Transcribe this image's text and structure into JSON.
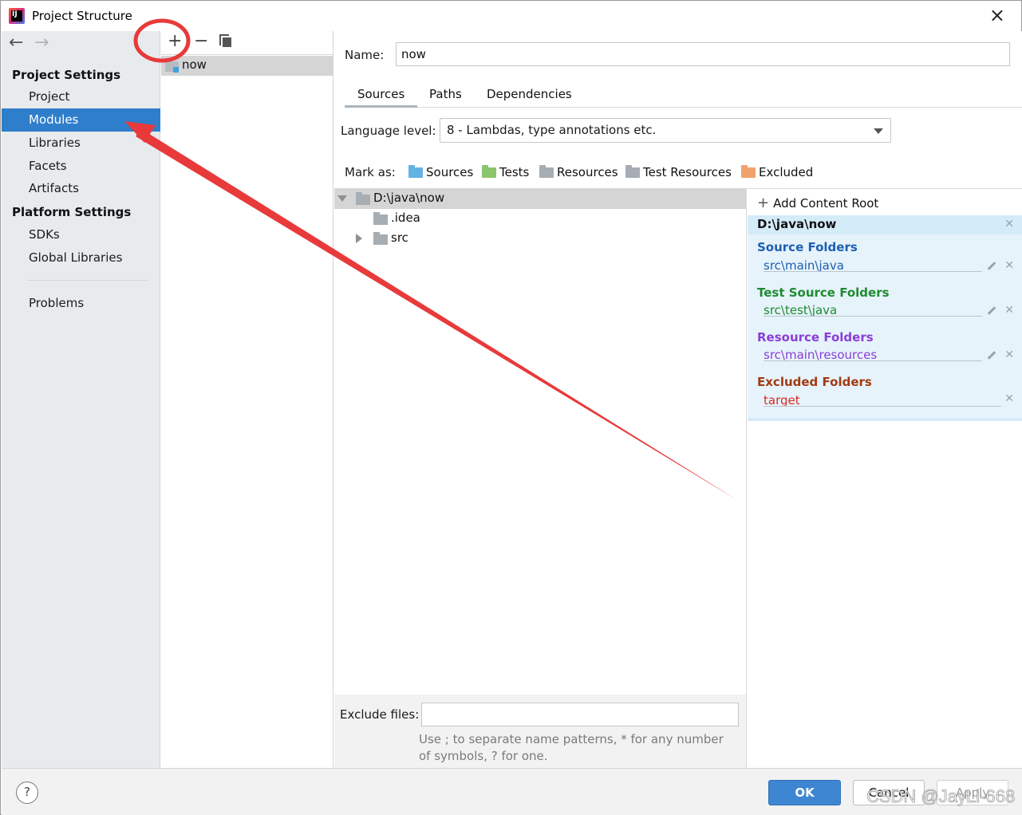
{
  "window": {
    "title": "Project Structure",
    "close_label": "×"
  },
  "nav": {
    "back": "←",
    "forward": "→"
  },
  "sidebar": {
    "project_settings_header": "Project Settings",
    "project_settings": [
      "Project",
      "Modules",
      "Libraries",
      "Facets",
      "Artifacts"
    ],
    "selected": "Modules",
    "platform_settings_header": "Platform Settings",
    "platform_settings": [
      "SDKs",
      "Global Libraries"
    ],
    "problems": "Problems"
  },
  "modules_toolbar": {
    "add": "+",
    "remove": "−"
  },
  "modules": [
    "now"
  ],
  "module": {
    "name_label": "Name:",
    "name_value": "now",
    "tabs": [
      "Sources",
      "Paths",
      "Dependencies"
    ],
    "active_tab": "Sources",
    "language_level_label": "Language level:",
    "language_level_value": "8 - Lambdas, type annotations etc.",
    "mark_as_label": "Mark as:",
    "mark_as": [
      {
        "label": "Sources",
        "color": "#62b2e4"
      },
      {
        "label": "Tests",
        "color": "#8bc56e"
      },
      {
        "label": "Resources",
        "color": "#a6adb3"
      },
      {
        "label": "Test Resources",
        "color": "#a6adb3"
      },
      {
        "label": "Excluded",
        "color": "#f0a36c"
      }
    ]
  },
  "tree": {
    "root": "D:\\java\\now",
    "children": [
      ".idea",
      "src"
    ]
  },
  "content_root": {
    "add_label": "Add Content Root",
    "path": "D:\\java\\now",
    "groups": [
      {
        "title": "Source Folders",
        "item": "src\\main\\java",
        "color": "#1f5fb0",
        "item_color": "#1f5fb0"
      },
      {
        "title": "Test Source Folders",
        "item": "src\\test\\java",
        "color": "#1e8a2f",
        "item_color": "#1e8a2f"
      },
      {
        "title": "Resource Folders",
        "item": "src\\main\\resources",
        "color": "#8a3ed6",
        "item_color": "#8a3ed6"
      },
      {
        "title": "Excluded Folders",
        "item": "target",
        "color": "#a23a12",
        "item_color": "#d9281f"
      }
    ]
  },
  "exclude": {
    "label": "Exclude files:",
    "value": "",
    "hint": "Use ; to separate name patterns, * for any number of symbols, ? for one."
  },
  "footer": {
    "help": "?",
    "ok": "OK",
    "cancel": "Cancel",
    "apply": "Apply"
  },
  "watermark": "CSDN @JayLi-668",
  "annotation_color": "#e83a3a"
}
